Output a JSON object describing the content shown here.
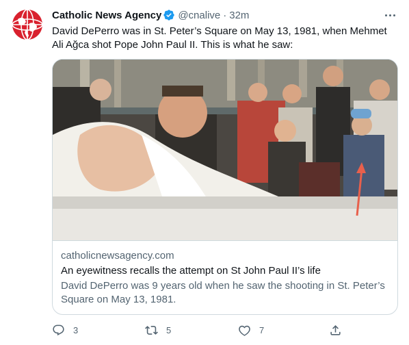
{
  "tweet": {
    "author_name": "Catholic News Agency",
    "handle": "@cnalive",
    "separator": "·",
    "time": "32m",
    "text": "David DePerro was in St. Peter’s Square on May 13, 1981, when Mehmet Ali Ağca shot Pope John Paul II. This is what he saw:"
  },
  "card": {
    "domain": "catholicnewsagency.com",
    "title": "An eyewitness recalls the attempt on St John Paul II’s life",
    "description": "David DePerro was 9 years old when he saw the shooting in St. Peter’s Square on May 13, 1981."
  },
  "actions": {
    "reply_count": "3",
    "retweet_count": "5",
    "like_count": "7"
  },
  "icons": {
    "avatar": "cna-globe-logo",
    "verified": "verified-badge-icon",
    "more": "more-options-icon",
    "reply": "reply-icon",
    "retweet": "retweet-icon",
    "like": "heart-icon",
    "share": "share-icon"
  },
  "colors": {
    "text": "#0f1419",
    "secondary": "#536471",
    "verified": "#1d9bf0",
    "border": "#cfd9de",
    "logo_red": "#d9212e",
    "arrow": "#e8604c"
  }
}
